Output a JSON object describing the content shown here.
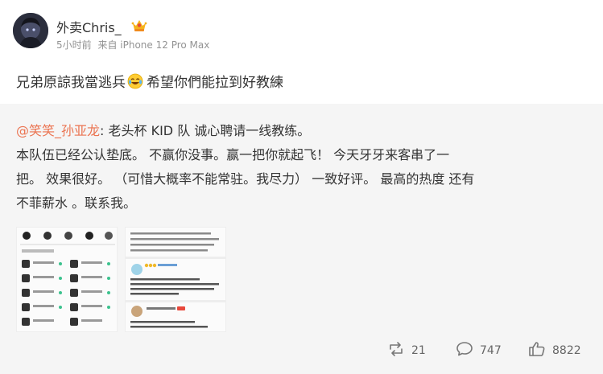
{
  "user": {
    "name": "外卖Chris_",
    "time": "5小时前",
    "source": "来自 iPhone 12 Pro Max"
  },
  "post": {
    "text_before_emoji": "兄弟原諒我當逃兵",
    "emoji": "laughing-crying-emoji",
    "text_after_emoji": "希望你們能拉到好教練"
  },
  "repost": {
    "mention": "@笑笑_孙亚龙",
    "line1_rest": ": 老头杯 KID 队 诚心聘请一线教练。",
    "line2": "本队伍已经公认垫底。 不赢你没事。赢一把你就起飞！ 今天牙牙来客串了一",
    "line3": "把。 效果很好。 （可惜大概率不能常驻。我尽力） 一致好评。 最高的热度 还有",
    "line4": "不菲薪水 。联系我。"
  },
  "actions": {
    "reposts": "21",
    "comments": "747",
    "likes": "8822"
  },
  "colors": {
    "mention": "#eb7350",
    "meta": "#939393",
    "repost_bg": "#f5f5f5"
  },
  "icons": [
    "verified-crown-icon",
    "repost-icon",
    "comment-icon",
    "like-icon"
  ]
}
